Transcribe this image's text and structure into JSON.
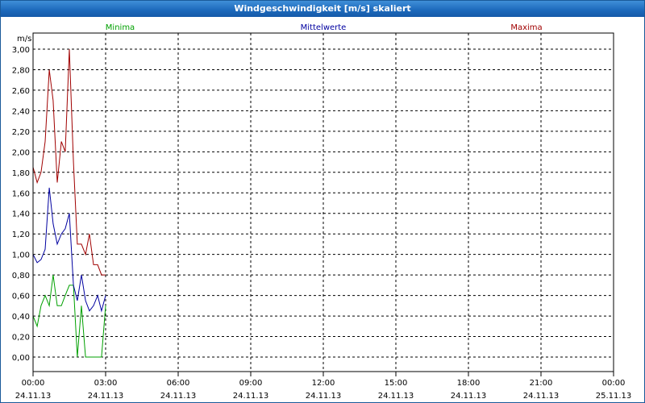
{
  "window": {
    "title": "Windgeschwindigkeit [m/s] skaliert"
  },
  "chart_data": {
    "type": "line",
    "title": "Windgeschwindigkeit [m/s] skaliert",
    "ylabel": "m/s",
    "ylim": [
      0,
      3.0
    ],
    "yticks": [
      "0,00",
      "0,20",
      "0,40",
      "0,60",
      "0,80",
      "1,00",
      "1,20",
      "1,40",
      "1,60",
      "1,80",
      "2,00",
      "2,20",
      "2,40",
      "2,60",
      "2,80",
      "3,00"
    ],
    "xlim_hours": [
      0,
      24
    ],
    "xticks": [
      {
        "time": "00:00",
        "date": "24.11.13"
      },
      {
        "time": "03:00",
        "date": "24.11.13"
      },
      {
        "time": "06:00",
        "date": "24.11.13"
      },
      {
        "time": "09:00",
        "date": "24.11.13"
      },
      {
        "time": "12:00",
        "date": "24.11.13"
      },
      {
        "time": "15:00",
        "date": "24.11.13"
      },
      {
        "time": "18:00",
        "date": "24.11.13"
      },
      {
        "time": "21:00",
        "date": "24.11.13"
      },
      {
        "time": "00:00",
        "date": "25.11.13"
      }
    ],
    "grid": true,
    "legend_position": "top",
    "x": [
      0.0,
      0.17,
      0.33,
      0.5,
      0.67,
      0.83,
      1.0,
      1.17,
      1.33,
      1.5,
      1.67,
      1.83,
      2.0,
      2.17,
      2.33,
      2.5,
      2.67,
      2.83,
      3.0
    ],
    "series": [
      {
        "name": "Minima",
        "color": "#00a000",
        "values": [
          0.4,
          0.3,
          0.5,
          0.6,
          0.5,
          0.8,
          0.5,
          0.5,
          0.6,
          0.7,
          0.7,
          0.0,
          0.5,
          0.0,
          0.0,
          0.0,
          0.0,
          0.0,
          0.5
        ]
      },
      {
        "name": "Mittelwerte",
        "color": "#0000a0",
        "values": [
          1.0,
          0.92,
          0.95,
          1.05,
          1.65,
          1.3,
          1.1,
          1.2,
          1.25,
          1.4,
          0.7,
          0.55,
          0.8,
          0.55,
          0.45,
          0.5,
          0.6,
          0.45,
          0.6
        ]
      },
      {
        "name": "Maxima",
        "color": "#a00000",
        "values": [
          1.85,
          1.7,
          1.8,
          2.1,
          2.8,
          2.5,
          1.7,
          2.1,
          2.0,
          3.0,
          1.9,
          1.1,
          1.1,
          1.0,
          1.2,
          0.9,
          0.9,
          0.8,
          0.8
        ]
      }
    ]
  }
}
